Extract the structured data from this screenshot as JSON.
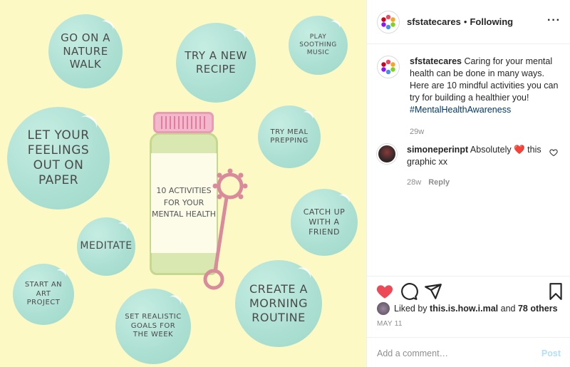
{
  "post_image": {
    "bottle_label": "10 Activities for your mental health",
    "bubbles": [
      "Go on a nature walk",
      "Try a new recipe",
      "Play soothing music",
      "Let your feelings out on paper",
      "Try meal prepping",
      "Meditate",
      "Catch up with a friend",
      "Start an art project",
      "Set realistic goals for the week",
      "Create a morning routine"
    ]
  },
  "header": {
    "username": "sfstatecares",
    "separator": "•",
    "follow_status": "Following",
    "more_icon": "more-dots-icon"
  },
  "caption": {
    "username": "sfstatecares",
    "text": "Caring for your mental health can be done in many ways. Here are 10 mindful activities you can try for building a healthier you!",
    "hashtag": "#MentalHealthAwareness",
    "time": "29w"
  },
  "comment": {
    "username": "simoneperinpt",
    "text_before": "Absolutely",
    "emoji": "❤️",
    "text_after": "this graphic xx",
    "time": "28w",
    "reply_label": "Reply"
  },
  "actions": {
    "like_icon": "heart-filled-icon",
    "comment_icon": "comment-bubble-icon",
    "share_icon": "paper-plane-icon",
    "save_icon": "bookmark-icon",
    "like_color": "#ed4956"
  },
  "likes": {
    "prefix": "Liked by",
    "user": "this.is.how.i.mal",
    "conjunction": "and",
    "others": "78 others"
  },
  "date": "MAY 11",
  "add_comment": {
    "placeholder": "Add a comment…",
    "post_label": "Post"
  }
}
